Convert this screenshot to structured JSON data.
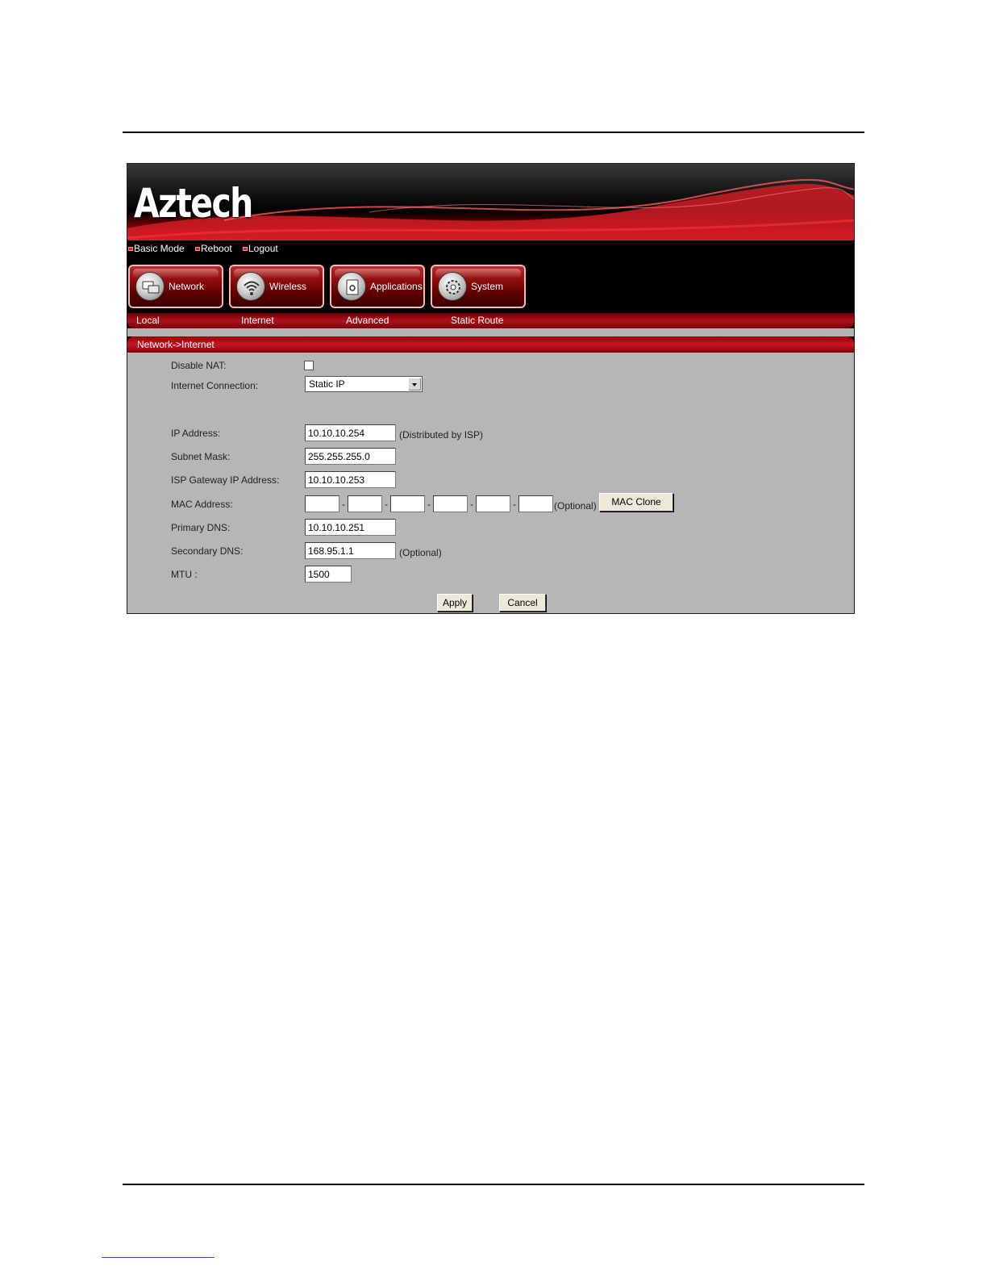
{
  "brand": {
    "logo_text": "Aztech"
  },
  "quick_links": [
    {
      "label": "Basic Mode"
    },
    {
      "label": "Reboot"
    },
    {
      "label": "Logout"
    }
  ],
  "main_nav": [
    {
      "label": "Network",
      "icon": "network-icon"
    },
    {
      "label": "Wireless",
      "icon": "wireless-icon"
    },
    {
      "label": "Applications",
      "icon": "applications-icon"
    },
    {
      "label": "System",
      "icon": "system-gear-icon"
    }
  ],
  "sub_nav": [
    {
      "label": "Local"
    },
    {
      "label": "Internet"
    },
    {
      "label": "Advanced"
    },
    {
      "label": "Static Route"
    }
  ],
  "breadcrumb": "Network->Internet",
  "form": {
    "disable_nat": {
      "label": "Disable NAT:",
      "checked": false
    },
    "internet_connection": {
      "label": "Internet Connection:",
      "selected": "Static IP"
    },
    "ip_address": {
      "label": "IP Address:",
      "value": "10.10.10.254",
      "hint": "(Distributed by ISP)"
    },
    "subnet_mask": {
      "label": "Subnet Mask:",
      "value": "255.255.255.0"
    },
    "gateway": {
      "label": "ISP Gateway IP Address:",
      "value": "10.10.10.253"
    },
    "mac_address": {
      "label": "MAC Address:",
      "octets": [
        "",
        "",
        "",
        "",
        "",
        ""
      ],
      "separator": "-",
      "hint": "(Optional)",
      "clone_button": "MAC Clone"
    },
    "primary_dns": {
      "label": "Primary DNS:",
      "value": "10.10.10.251"
    },
    "secondary_dns": {
      "label": "Secondary DNS:",
      "value": "168.95.1.1",
      "hint": "(Optional)"
    },
    "mtu": {
      "label": "MTU :",
      "value": "1500"
    }
  },
  "actions": {
    "apply": "Apply",
    "cancel": "Cancel"
  },
  "colors": {
    "brand_red": "#c41822",
    "form_bg": "#b6b6b6",
    "nav_border": "#f2b9b9"
  }
}
